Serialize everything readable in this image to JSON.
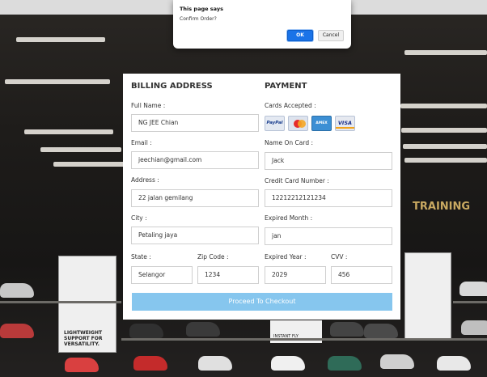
{
  "dialog": {
    "title": "This page says",
    "message": "Confirm Order?",
    "ok_label": "OK",
    "cancel_label": "Cancel"
  },
  "background": {
    "sign_text": "TRAINING",
    "poster_left_text": "LIGHTWEIGHT SUPPORT FOR VERSATILITY.",
    "poster_center_text": "INSTANT FLY"
  },
  "billing": {
    "title": "BILLING ADDRESS",
    "full_name_label": "Full Name :",
    "full_name_value": "NG JEE Chian",
    "email_label": "Email :",
    "email_value": "jeechian@gmail.com",
    "address_label": "Address :",
    "address_value": "22 jalan gemilang",
    "city_label": "City :",
    "city_value": "Petaling jaya",
    "state_label": "State :",
    "state_value": "Selangor",
    "zip_label": "Zip Code :",
    "zip_value": "1234"
  },
  "payment": {
    "title": "PAYMENT",
    "cards_label": "Cards Accepted :",
    "cards": [
      "PayPal",
      "MasterCard",
      "AMERICAN EXPRESS",
      "VISA"
    ],
    "name_on_card_label": "Name On Card :",
    "name_on_card_value": "Jack",
    "card_number_label": "Credit Card Number :",
    "card_number_value": "12212212121234",
    "exp_month_label": "Expired Month :",
    "exp_month_value": "jan",
    "exp_year_label": "Expired Year :",
    "exp_year_value": "2029",
    "cvv_label": "CVV :",
    "cvv_value": "456"
  },
  "submit_label": "Proceed To Checkout",
  "colors": {
    "submit_bg": "#86c6ee",
    "ok_button": "#1a73e8"
  }
}
